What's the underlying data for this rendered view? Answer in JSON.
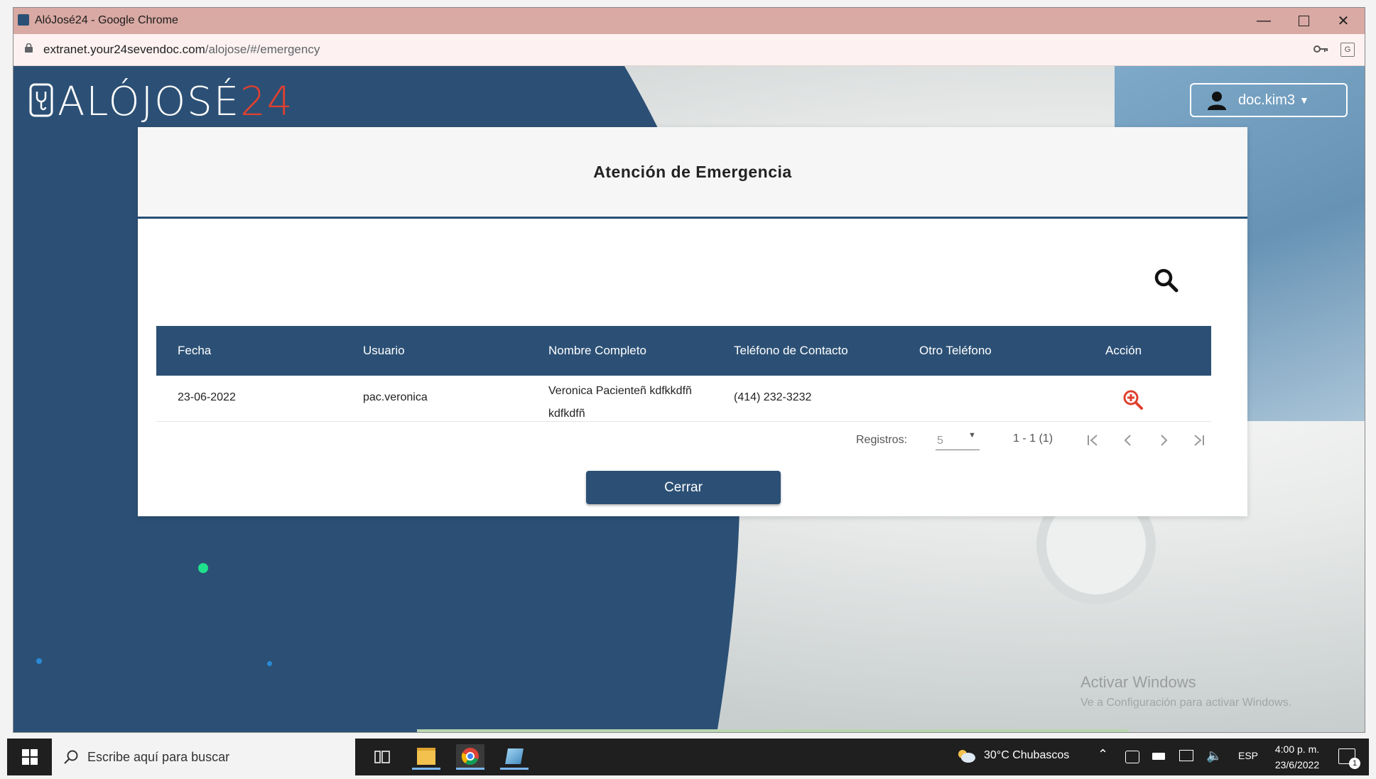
{
  "browser": {
    "title": "AlóJosé24 - Google Chrome",
    "url_main": "extranet.your24sevendoc.com",
    "url_path": "/alojose/#/emergency"
  },
  "app": {
    "logo_text": "ALÓJOSÉ24",
    "user": "doc.kim3"
  },
  "modal": {
    "title": "Atención de Emergencia",
    "columns": [
      "Fecha",
      "Usuario",
      "Nombre Completo",
      "Teléfono de Contacto",
      "Otro Teléfono",
      "Acción"
    ],
    "rows": [
      {
        "fecha": "23-06-2022",
        "usuario": "pac.veronica",
        "nombre_line1": "Veronica Pacienteñ kdfkkdfñ",
        "nombre_line2": "kdfkdfñ",
        "telefono": "(414) 232-3232",
        "otro_telefono": ""
      }
    ],
    "pager": {
      "label": "Registros:",
      "per_page": "5",
      "range": "1 - 1 (1)"
    },
    "close_label": "Cerrar"
  },
  "watermark": {
    "line1": "Activar Windows",
    "line2": "Ve a Configuración para activar Windows."
  },
  "taskbar": {
    "search_placeholder": "Escribe aquí para buscar",
    "weather": "30°C  Chubascos",
    "lang": "ESP",
    "time": "4:00 p. m.",
    "date": "23/6/2022",
    "notif_count": "1"
  },
  "colors": {
    "navy": "#2c5075",
    "accent_red": "#e0402f",
    "title_bar": "#d9a9a3"
  }
}
